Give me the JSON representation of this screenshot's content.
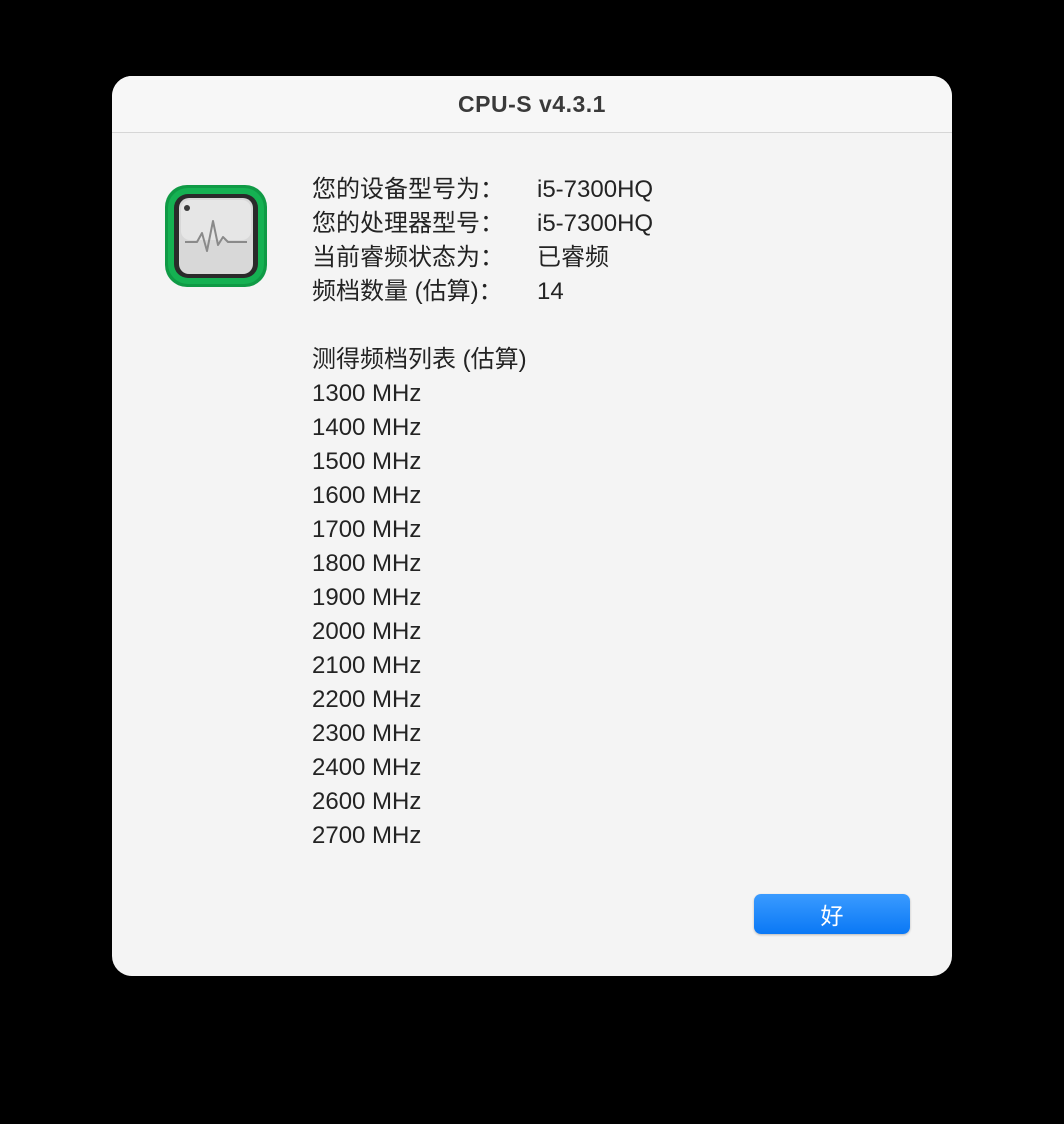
{
  "window": {
    "title": "CPU-S v4.3.1"
  },
  "icon": {
    "name": "activity-monitor-icon",
    "accent": "#0f9a45"
  },
  "info": [
    {
      "label": "您的设备型号为：",
      "value": "i5-7300HQ"
    },
    {
      "label": "您的处理器型号：",
      "value": "i5-7300HQ"
    },
    {
      "label": "当前睿频状态为：",
      "value": "已睿频"
    },
    {
      "label": "频档数量 (估算)：",
      "value": "14"
    }
  ],
  "frequencies": {
    "heading": "测得频档列表 (估算)",
    "items": [
      "1300 MHz",
      "1400 MHz",
      "1500 MHz",
      "1600 MHz",
      "1700 MHz",
      "1800 MHz",
      "1900 MHz",
      "2000 MHz",
      "2100 MHz",
      "2200 MHz",
      "2300 MHz",
      "2400 MHz",
      "2600 MHz",
      "2700 MHz"
    ]
  },
  "buttons": {
    "ok_label": "好",
    "ok_color": "#0a78f5"
  }
}
